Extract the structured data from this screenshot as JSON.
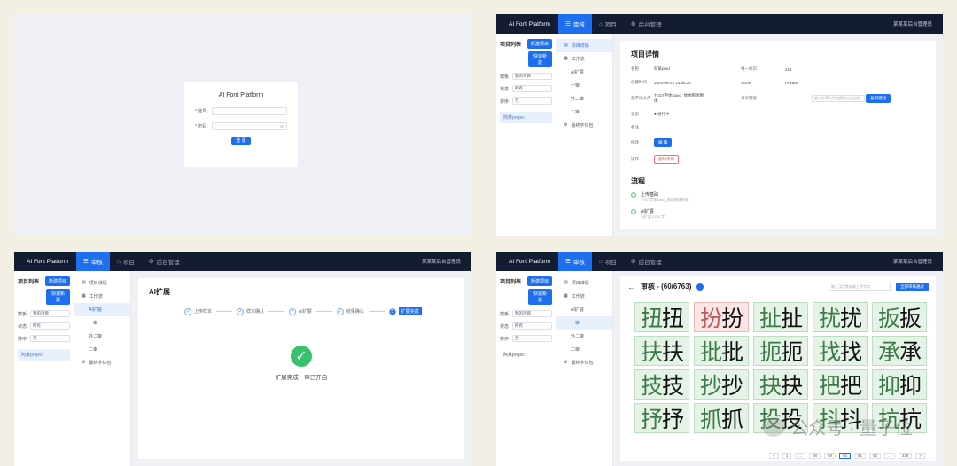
{
  "login": {
    "title": "AI Font Platform",
    "account_label": "* 账号:",
    "password_label": "* 密码:",
    "login_button": "登 录"
  },
  "common": {
    "brand": "AI Font Platform",
    "nav": [
      "审核",
      "项目",
      "后台管理"
    ],
    "user": "某某某后台管理员",
    "project_list": "项目列表",
    "new_project": "新建项目",
    "import_project": "快速新建",
    "filters": [
      {
        "label": "模板",
        "value": "我的项目"
      },
      {
        "label": "状态",
        "value": "所有"
      },
      {
        "label": "排序",
        "value": "无"
      }
    ],
    "project_item": "阿某project",
    "menu": {
      "detail": "项目详情",
      "workflow": "工作流",
      "ai_expand": "AI扩展",
      "round1": "一审",
      "round2": "外二审",
      "round3": "二审",
      "download": "最终字体包"
    }
  },
  "details": {
    "title": "项目详情",
    "rows": [
      {
        "k1": "名称",
        "v1": "阿某pmd",
        "k2": "唯一标识",
        "v2": "214"
      },
      {
        "k1": "创建时间",
        "v1": "2024-05-22 14:58:20",
        "k2": "Mode",
        "v2": "Private"
      },
      {
        "k1": "基字体文件",
        "v1": "TEST字体Sang_体体制体制体",
        "k2": "分享链接",
        "v2": ""
      },
      {
        "k1": "状态",
        "v1": "● 进行中",
        "k2": "",
        "v2": ""
      },
      {
        "k1": "备注",
        "v1": "",
        "k2": "",
        "v2": ""
      }
    ],
    "share_placeholder": "输入分享文件链接或点击右侧",
    "share_button": "复制链接",
    "edit_label": "修改",
    "edit_button": "编 辑",
    "delete_label": "操作",
    "delete_button": "删除项目",
    "flow_title": "流程",
    "flow_steps": [
      {
        "title": "上传基础",
        "sub": "TEST字体Sang_体体制体制体"
      },
      {
        "title": "AI扩展",
        "sub": "已扩展 6763 字"
      }
    ]
  },
  "expand": {
    "title": "AI扩展",
    "steps": [
      "上传样本",
      "样本确认",
      "AI扩展",
      "结果确认",
      "扩展完成"
    ],
    "done_text": "扩展完成一审已开启"
  },
  "review": {
    "title": "审核 - (60/6763)",
    "search_placeholder": "输入汉字查询或上传字库",
    "submit_button": "全部审核通过",
    "glyphs": [
      "扭",
      "扮",
      "扯",
      "扰",
      "扳",
      "扶",
      "批",
      "扼",
      "找",
      "承",
      "技",
      "抄",
      "抉",
      "把",
      "抑",
      "抒",
      "抓",
      "投",
      "抖",
      "抗"
    ],
    "pager": [
      "<",
      "1",
      "...",
      "58",
      "59",
      "60",
      "61",
      "62",
      "...",
      "338",
      ">"
    ]
  },
  "watermark": "公众号 · 量子位"
}
